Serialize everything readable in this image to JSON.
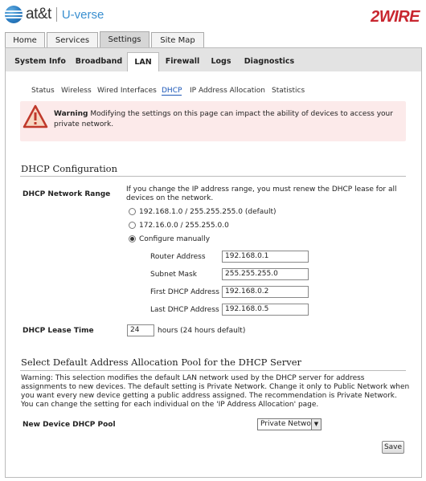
{
  "header": {
    "brand": "at&t",
    "product": "U-verse",
    "vendor": "2WIRE"
  },
  "top_tabs": [
    "Home",
    "Services",
    "Settings",
    "Site Map"
  ],
  "sub_tabs": [
    "System Info",
    "Broadband",
    "LAN",
    "Firewall",
    "Logs",
    "Diagnostics"
  ],
  "lan_menu": [
    "Status",
    "Wireless",
    "Wired Interfaces",
    "DHCP",
    "IP Address Allocation",
    "Statistics"
  ],
  "warning": {
    "title": "Warning",
    "text": "Modifying the settings on this page can impact the ability of devices to access your private network."
  },
  "dhcp": {
    "section_title": "DHCP Configuration",
    "range_label": "DHCP Network Range",
    "range_note": "If you change the IP address range, you must renew the DHCP lease for all devices on the network.",
    "options": [
      "192.168.1.0 / 255.255.255.0 (default)",
      "172.16.0.0 / 255.255.0.0",
      "Configure manually"
    ],
    "selected_option": 2,
    "fields": {
      "router_address": {
        "label": "Router Address",
        "value": "192.168.0.1"
      },
      "subnet_mask": {
        "label": "Subnet Mask",
        "value": "255.255.255.0"
      },
      "first_dhcp": {
        "label": "First DHCP Address",
        "value": "192.168.0.2"
      },
      "last_dhcp": {
        "label": "Last DHCP Address",
        "value": "192.168.0.5"
      }
    },
    "lease_label": "DHCP Lease Time",
    "lease_value": "24",
    "lease_note": "hours (24 hours default)"
  },
  "pool": {
    "section_title": "Select Default Address Allocation Pool for the DHCP Server",
    "warning_text": "Warning: This selection modifies the default LAN network used by the DHCP server for address assignments to new devices. The default setting is Private Network. Change it only to Public Network when you want every new device getting a public address assigned. The recommendation is Private Network. You can change the setting for each individual on the 'IP Address Allocation' page.",
    "label": "New Device DHCP Pool",
    "selected": "Private Network"
  },
  "save_label": "Save",
  "colors": {
    "accent": "#1a56b7",
    "brand_red": "#c8262f",
    "warning_bg": "#fceaea",
    "tab_active": "#d6d6d6"
  }
}
